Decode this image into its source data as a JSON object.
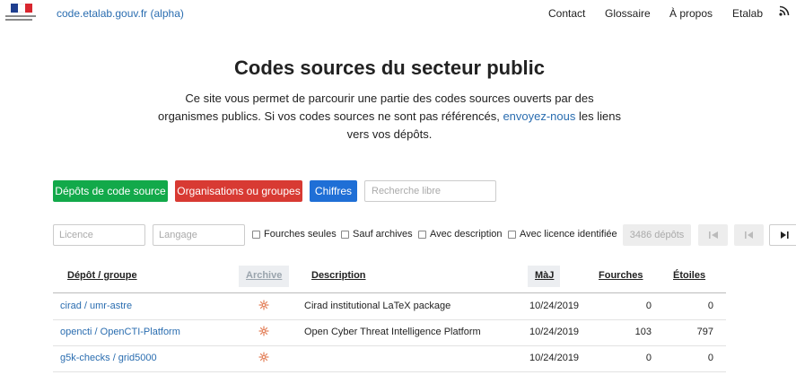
{
  "header": {
    "site_link": "code.etalab.gouv.fr (alpha)",
    "nav": [
      "Contact",
      "Glossaire",
      "À propos",
      "Etalab"
    ],
    "icons": {
      "logo": "marianne-logo",
      "rss": "rss-icon"
    },
    "colors": {
      "link": "#2a6db0"
    }
  },
  "hero": {
    "title": "Codes sources du secteur public",
    "intro_before": "Ce site vous permet de parcourir une partie des codes sources ouverts par des organismes publics. Si vos codes sources ne sont pas référencés, ",
    "intro_link": "envoyez-nous",
    "intro_after": " les liens vers vos dépôts."
  },
  "actions": {
    "repos": "Dépôts de code source",
    "orgs": "Organisations ou groupes",
    "stats": "Chiffres",
    "search_placeholder": "Recherche libre",
    "colors": {
      "repos": "#12a94a",
      "orgs": "#d83a33",
      "stats": "#1f6fd6"
    }
  },
  "filters": {
    "licence_placeholder": "Licence",
    "language_placeholder": "Langage",
    "checkboxes": [
      "Fourches seules",
      "Sauf archives",
      "Avec description",
      "Avec licence identifiée"
    ],
    "count": "3486 dépôts"
  },
  "table": {
    "headers": [
      "Dépôt / groupe",
      "Archive",
      "Description",
      "MàJ",
      "Fourches",
      "Étoiles"
    ],
    "rows": [
      {
        "repo": "cirad / umr-astre",
        "description": "Cirad institutional LaTeX package",
        "updated": "10/24/2019",
        "forks": "0",
        "stars": "0"
      },
      {
        "repo": "opencti / OpenCTI-Platform",
        "description": "Open Cyber Threat Intelligence Platform",
        "updated": "10/24/2019",
        "forks": "103",
        "stars": "797"
      },
      {
        "repo": "g5k-checks / grid5000",
        "description": "",
        "updated": "10/24/2019",
        "forks": "0",
        "stars": "0"
      }
    ]
  }
}
